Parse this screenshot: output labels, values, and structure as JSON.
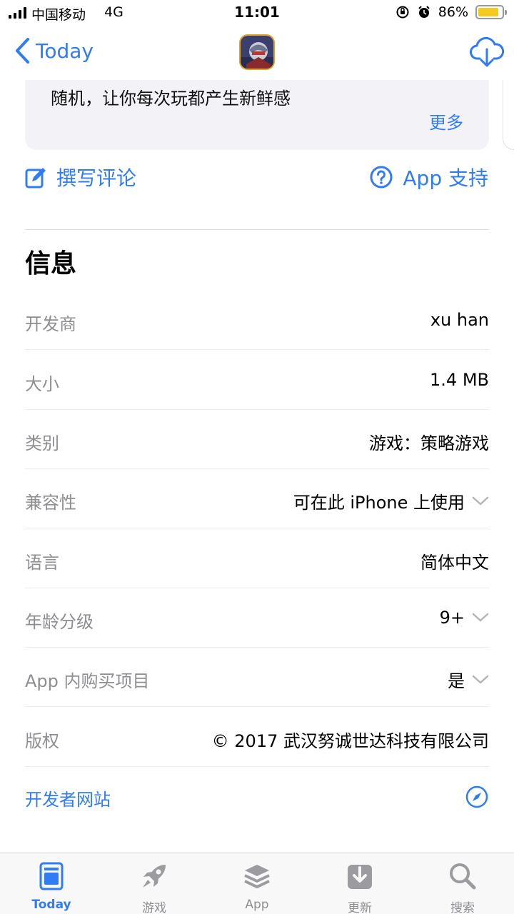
{
  "status_bar": {
    "carrier": "中国移动",
    "network": "4G",
    "time": "11:01",
    "battery": "86%",
    "battery_level": 0.86
  },
  "nav": {
    "back_label": "Today"
  },
  "description": {
    "visible_line": "随机，让你每次玩都产生新鲜感",
    "more_label": "更多"
  },
  "actions": {
    "write_review": "撰写评论",
    "app_support": "App 支持"
  },
  "info": {
    "title": "信息",
    "rows": [
      {
        "label": "开发商",
        "value": "xu han"
      },
      {
        "label": "大小",
        "value": "1.4 MB"
      },
      {
        "label": "类别",
        "value": "游戏：策略游戏"
      },
      {
        "label": "兼容性",
        "value": "可在此 iPhone 上使用"
      },
      {
        "label": "语言",
        "value": "简体中文"
      },
      {
        "label": "年龄分级",
        "value": "9+"
      },
      {
        "label": "App 内购买项目",
        "value": "是"
      },
      {
        "label": "版权",
        "value": "© 2017 武汉努诚世达科技有限公司"
      }
    ],
    "developer_site": "开发者网站"
  },
  "tabs": [
    {
      "label": "Today",
      "icon": "today-icon",
      "active": true
    },
    {
      "label": "游戏",
      "icon": "rocket-icon",
      "active": false
    },
    {
      "label": "App",
      "icon": "layers-icon",
      "active": false
    },
    {
      "label": "更新",
      "icon": "download-tray-icon",
      "active": false
    },
    {
      "label": "搜索",
      "icon": "search-icon",
      "active": false
    }
  ],
  "colors": {
    "accent": "#2f7cf6",
    "label_gray": "#8e8e93",
    "card_bg": "#f2f2f7",
    "battery": "#f7c81e"
  }
}
